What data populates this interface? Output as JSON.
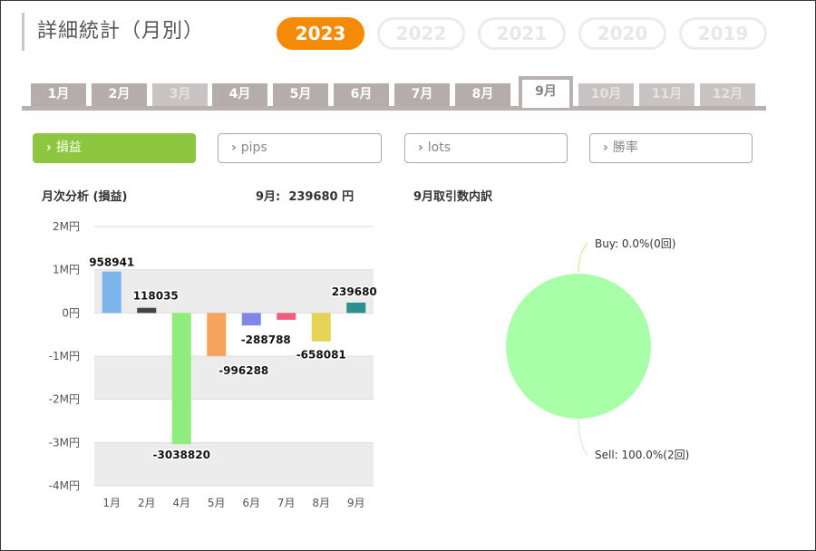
{
  "page": {
    "title": "詳細統計（月別）"
  },
  "years": [
    {
      "label": "2023",
      "active": true
    },
    {
      "label": "2022",
      "active": false
    },
    {
      "label": "2021",
      "active": false
    },
    {
      "label": "2020",
      "active": false
    },
    {
      "label": "2019",
      "active": false
    }
  ],
  "months": [
    {
      "label": "1月",
      "state": "normal"
    },
    {
      "label": "2月",
      "state": "normal"
    },
    {
      "label": "3月",
      "state": "dim"
    },
    {
      "label": "4月",
      "state": "normal"
    },
    {
      "label": "5月",
      "state": "normal"
    },
    {
      "label": "6月",
      "state": "normal"
    },
    {
      "label": "7月",
      "state": "normal"
    },
    {
      "label": "8月",
      "state": "normal"
    },
    {
      "label": "9月",
      "state": "active"
    },
    {
      "label": "10月",
      "state": "dim"
    },
    {
      "label": "11月",
      "state": "dim"
    },
    {
      "label": "12月",
      "state": "dim"
    }
  ],
  "filters": [
    {
      "label": "損益",
      "active": true
    },
    {
      "label": "pips",
      "active": false
    },
    {
      "label": "lots",
      "active": false
    },
    {
      "label": "勝率",
      "active": false
    }
  ],
  "monthly": {
    "title": "月次分析 (損益)",
    "summary_label": "9月:",
    "summary_value": "239680 円"
  },
  "breakdown": {
    "title": "9月取引数内訳",
    "buy_label": "Buy: 0.0%(0回)",
    "sell_label": "Sell: 100.0%(2回)"
  },
  "chart_data": [
    {
      "type": "bar",
      "categories": [
        "1月",
        "2月",
        "4月",
        "5月",
        "6月",
        "7月",
        "8月",
        "9月"
      ],
      "values": [
        958941,
        118035,
        -3038820,
        -996288,
        -288788,
        -158000,
        -658081,
        239680
      ],
      "data_labels": [
        "958941",
        "118035",
        "-3038820",
        "-996288",
        "-288788",
        "",
        "-658081",
        "239680"
      ],
      "colors": [
        "#7cb5ec",
        "#434348",
        "#90ed7d",
        "#f7a35c",
        "#8085e9",
        "#f15c80",
        "#e4d354",
        "#2b908f"
      ],
      "yticks": [
        {
          "value": 2000000,
          "label": "2M円"
        },
        {
          "value": 1000000,
          "label": "1M円"
        },
        {
          "value": 0,
          "label": "0円"
        },
        {
          "value": -1000000,
          "label": "-1M円"
        },
        {
          "value": -2000000,
          "label": "-2M円"
        },
        {
          "value": -3000000,
          "label": "-3M円"
        },
        {
          "value": -4000000,
          "label": "-4M円"
        }
      ],
      "ylim": [
        -4000000,
        2000000
      ]
    },
    {
      "type": "pie",
      "labels": [
        "Buy",
        "Sell"
      ],
      "values": [
        0,
        100
      ],
      "counts": [
        0,
        2
      ],
      "colors": [
        "#f7e3a0",
        "#a8ffa8"
      ]
    }
  ]
}
